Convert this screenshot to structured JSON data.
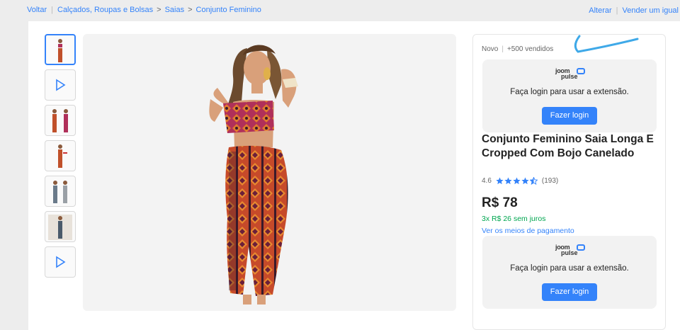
{
  "breadcrumb": {
    "back": "Voltar",
    "items": [
      "Calçados, Roupas e Bolsas",
      "Saias",
      "Conjunto Feminino"
    ]
  },
  "top_actions": {
    "alter": "Alterar",
    "sell": "Vender um igual"
  },
  "product": {
    "condition": "Novo",
    "sold": "+500 vendidos",
    "title": "Conjunto Feminino Saia Longa E Cropped Com Bojo Canelado",
    "rating": "4.6",
    "reviews": "(193)",
    "stars": 4.6,
    "price": "R$ 78",
    "installments": "3x R$ 26 sem juros",
    "payment_link": "Ver os meios de pagamento"
  },
  "extension": {
    "brand_line1": "joom",
    "brand_line2": "pulse",
    "message": "Faça login para usar a extensão.",
    "button": "Fazer login"
  },
  "thumbnails": [
    "photo",
    "video",
    "photo",
    "photo",
    "photo",
    "photo",
    "video"
  ],
  "colors": {
    "accent": "#3483fa",
    "green": "#00a650"
  }
}
